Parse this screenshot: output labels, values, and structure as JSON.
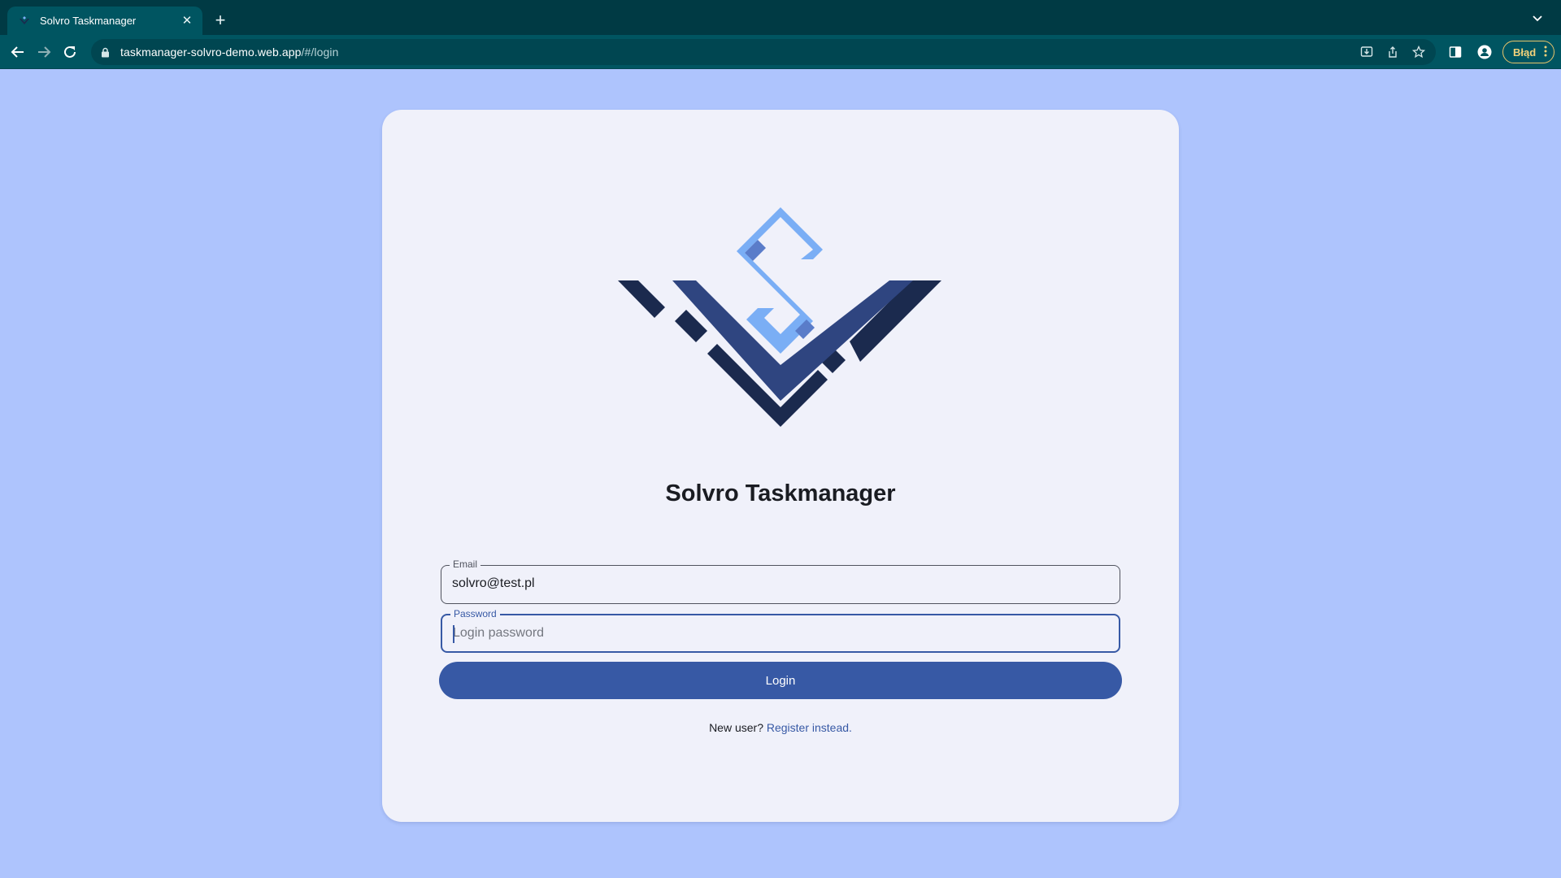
{
  "browser": {
    "tab_title": "Solvro Taskmanager",
    "tab_close": "✕",
    "new_tab": "+",
    "url_host": "taskmanager-solvro-demo.web.app",
    "url_path": "/#/login",
    "error_chip": "Błąd",
    "icons": [
      "back-icon",
      "forward-icon",
      "reload-icon",
      "lock-icon",
      "install-icon",
      "share-icon",
      "star-icon",
      "side-panel-icon",
      "profile-icon",
      "kebab-menu-icon",
      "tab-list-icon"
    ]
  },
  "page": {
    "title": "Solvro Taskmanager",
    "email": {
      "label": "Email",
      "value": "solvro@test.pl"
    },
    "password": {
      "label": "Password",
      "placeholder": "Login password"
    },
    "login_label": "Login",
    "register_prefix": "New user?",
    "register_link": "Register instead."
  },
  "colors": {
    "page_background": "#aec4fd",
    "card_background": "#f0f1fa",
    "primary": "#3759a5",
    "logo_dark": "#1b2a4e",
    "logo_mid": "#2f4580",
    "logo_light": "#7aaef5",
    "chrome_dark": "#003a44",
    "chrome_toolbar": "#005561"
  }
}
